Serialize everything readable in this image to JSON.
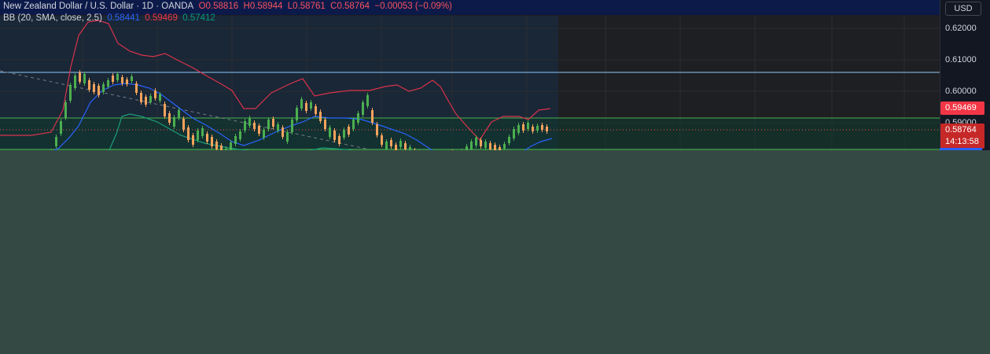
{
  "header": {
    "symbol": "New Zealand Dollar / U.S. Dollar · 1D · OANDA",
    "open": "O0.58816",
    "high": "H0.58944",
    "low": "L0.58761",
    "close": "C0.58764",
    "change": "−0.00053 (−0.09%)"
  },
  "indicator": {
    "name": "BB (20, SMA, close, 2.5)",
    "basis": "0.58441",
    "upper": "0.59469",
    "lower": "0.57412"
  },
  "price_axis": {
    "currency": "USD",
    "ticks": [
      "0.62000",
      "0.61000",
      "0.60000",
      "0.59000"
    ],
    "upper_band_tag": "0.59469",
    "last_price_tag": "0.58764",
    "countdown": "14:13:58"
  },
  "colors": {
    "bull": "#4caf50",
    "bear": "#f7a35c",
    "upper_band": "#d9334b",
    "basis": "#2962ff",
    "lower_band": "#1a9e79",
    "upper_tag": "#f23645",
    "last_tag": "#c62828"
  }
}
